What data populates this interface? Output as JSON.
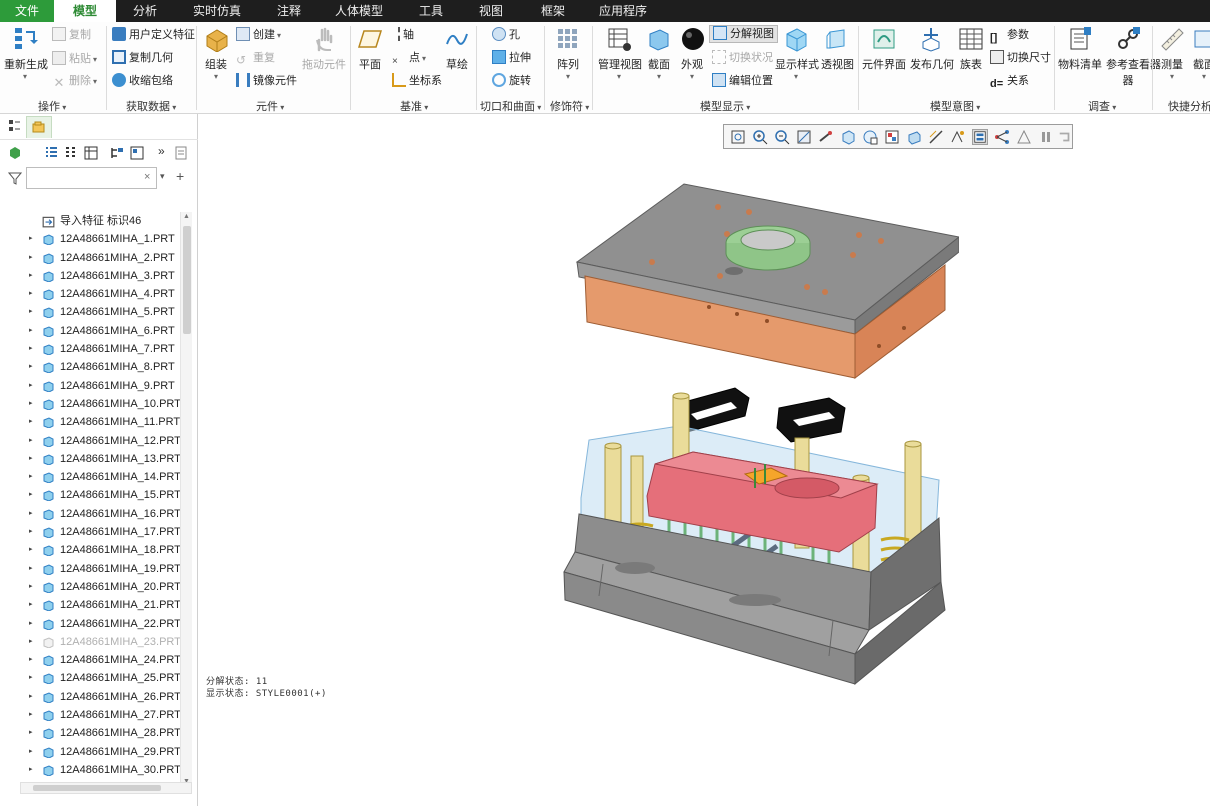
{
  "menu": {
    "tabs": [
      "文件",
      "模型",
      "分析",
      "实时仿真",
      "注释",
      "人体模型",
      "工具",
      "视图",
      "框架",
      "应用程序"
    ],
    "active": "模型"
  },
  "ribbon": {
    "groups": {
      "operations": "操作",
      "get_data": "获取数据",
      "component": "元件",
      "datum": "基准",
      "cut_surface": "切口和曲面",
      "modifier": "修饰符",
      "model_display": "模型显示",
      "model_intent": "模型意图",
      "investigate": "调查",
      "quick_analysis": "快捷分析"
    },
    "buttons": {
      "regenerate": "重新生成",
      "copy": "复制",
      "paste": "粘贴",
      "delete": "删除",
      "user_defined_feature": "用户定义特征",
      "copy_geometry": "复制几何",
      "shrinkwrap": "收缩包络",
      "assemble": "组装",
      "create": "创建",
      "repeat": "重复",
      "mirror_component": "镜像元件",
      "drag_component": "拖动元件",
      "plane": "平面",
      "axis": "轴",
      "point": "点",
      "csys": "坐标系",
      "sketch": "草绘",
      "hole": "孔",
      "extrude": "拉伸",
      "revolve": "旋转",
      "pattern": "阵列",
      "manage_views": "管理视图",
      "section": "截面",
      "appearance": "外观",
      "explode_view": "分解视图",
      "toggle_status": "切换状况",
      "edit_position": "编辑位置",
      "display_style": "显示样式",
      "perspective": "透视图",
      "component_interface": "元件界面",
      "publish_geometry": "发布几何",
      "family_table": "族表",
      "parameters": "参数",
      "switch_dimensions": "切换尺寸",
      "relations": "关系",
      "bom": "物料清单",
      "ref_viewer": "参考查看器",
      "measure": "测量",
      "section_short": "截面"
    }
  },
  "model_tree": {
    "filter_placeholder": "",
    "import_feature": "导入特征 标识46",
    "parts": [
      {
        "name": "12A48661MIHA_1.PRT"
      },
      {
        "name": "12A48661MIHA_2.PRT"
      },
      {
        "name": "12A48661MIHA_3.PRT"
      },
      {
        "name": "12A48661MIHA_4.PRT"
      },
      {
        "name": "12A48661MIHA_5.PRT"
      },
      {
        "name": "12A48661MIHA_6.PRT"
      },
      {
        "name": "12A48661MIHA_7.PRT"
      },
      {
        "name": "12A48661MIHA_8.PRT"
      },
      {
        "name": "12A48661MIHA_9.PRT"
      },
      {
        "name": "12A48661MIHA_10.PRT"
      },
      {
        "name": "12A48661MIHA_11.PRT"
      },
      {
        "name": "12A48661MIHA_12.PRT"
      },
      {
        "name": "12A48661MIHA_13.PRT"
      },
      {
        "name": "12A48661MIHA_14.PRT"
      },
      {
        "name": "12A48661MIHA_15.PRT"
      },
      {
        "name": "12A48661MIHA_16.PRT"
      },
      {
        "name": "12A48661MIHA_17.PRT"
      },
      {
        "name": "12A48661MIHA_18.PRT"
      },
      {
        "name": "12A48661MIHA_19.PRT"
      },
      {
        "name": "12A48661MIHA_20.PRT"
      },
      {
        "name": "12A48661MIHA_21.PRT"
      },
      {
        "name": "12A48661MIHA_22.PRT"
      },
      {
        "name": "12A48661MIHA_23.PRT",
        "suppressed": true
      },
      {
        "name": "12A48661MIHA_24.PRT"
      },
      {
        "name": "12A48661MIHA_25.PRT"
      },
      {
        "name": "12A48661MIHA_26.PRT"
      },
      {
        "name": "12A48661MIHA_27.PRT"
      },
      {
        "name": "12A48661MIHA_28.PRT"
      },
      {
        "name": "12A48661MIHA_29.PRT"
      },
      {
        "name": "12A48661MIHA_30.PRT"
      }
    ]
  },
  "graphics": {
    "explode_state": "分解状态: 11",
    "style_state": "显示状态: STYLE0001(+)"
  },
  "colors": {
    "accent": "#2d9b3a",
    "plate_gray": "#8d8d8d",
    "cavity_orange": "#e8956a",
    "core_red": "#e0707a",
    "bushing_green": "#b8dcb0",
    "transparent_blue": "#bfdcf0",
    "pin_yellow": "#eadc9a"
  }
}
